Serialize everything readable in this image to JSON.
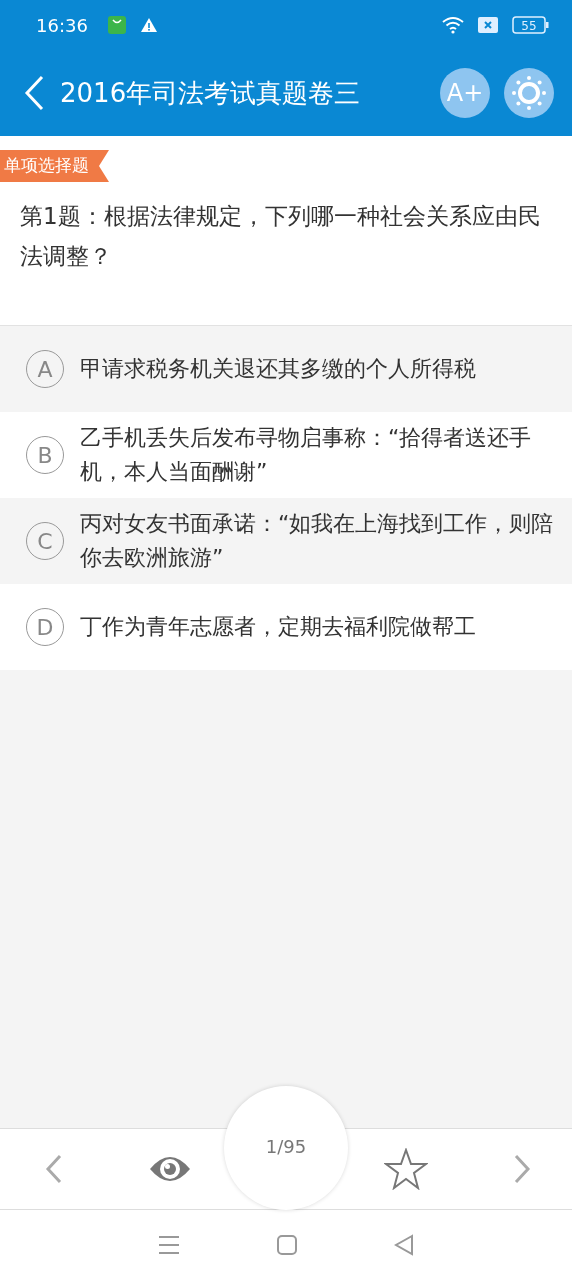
{
  "status_bar": {
    "time": "16:36",
    "battery": "55"
  },
  "header": {
    "title": "2016年司法考试真题卷三",
    "font_button": "A+"
  },
  "question": {
    "type_tag": "单项选择题",
    "text": "第1题：根据法律规定，下列哪一种社会关系应由民法调整？"
  },
  "options": [
    {
      "letter": "A",
      "text": "甲请求税务机关退还其多缴的个人所得税",
      "selected": false
    },
    {
      "letter": "B",
      "text": "乙手机丢失后发布寻物启事称：“拾得者送还手机，本人当面酬谢”",
      "selected": false
    },
    {
      "letter": "C",
      "text": "丙对女友书面承诺：“如我在上海找到工作，则陪你去欧洲旅游”",
      "selected": false
    },
    {
      "letter": "D",
      "text": "丁作为青年志愿者，定期去福利院做帮工",
      "selected": false
    }
  ],
  "pager": {
    "position": "1/95"
  }
}
